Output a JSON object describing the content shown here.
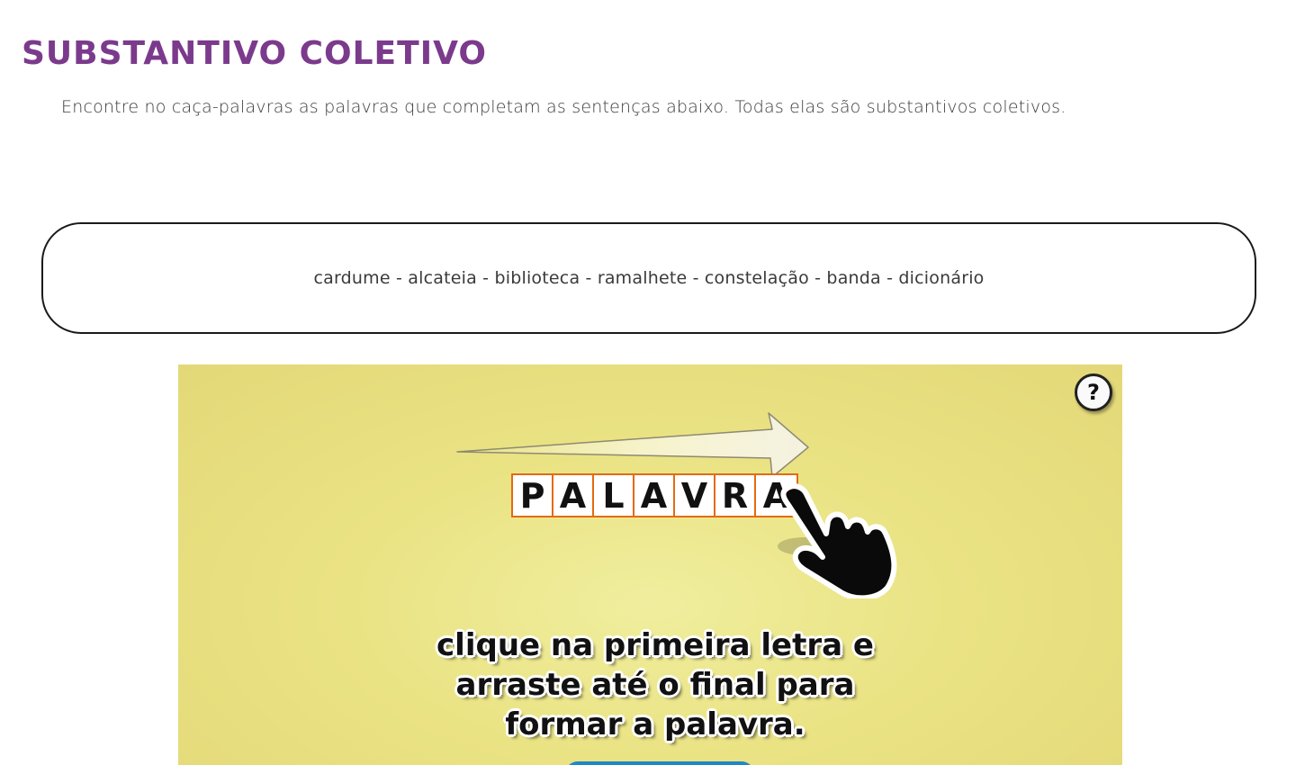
{
  "page": {
    "title": "SUBSTANTIVO COLETIVO",
    "instructions": "Encontre no caça-palavras as palavras que completam as sentenças abaixo. Todas elas são substantivos coletivos.",
    "word_list": "cardume - alcateia - biblioteca - ramalhete - constelação - banda - dicionário"
  },
  "game": {
    "help_label": "?",
    "demo_letters": [
      "P",
      "A",
      "L",
      "A",
      "V",
      "R",
      "A"
    ],
    "caption_lines": [
      "clique na primeira letra e",
      "arraste até o final para",
      "formar a palavra."
    ],
    "colors": {
      "background": "#eae384",
      "letter_border": "#e46a12",
      "title": "#7b3a8c",
      "start_button": "#1e88c7"
    },
    "icons": [
      "arrow-right-icon",
      "pointing-hand-icon",
      "question-mark-icon"
    ]
  }
}
